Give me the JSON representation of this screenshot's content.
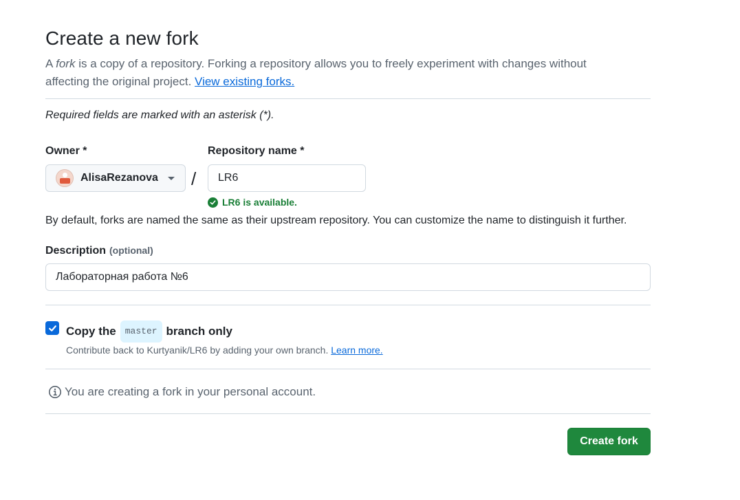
{
  "header": {
    "title": "Create a new fork",
    "intro_a": "A ",
    "intro_fork": "fork",
    "intro_b": " is a copy of a repository. Forking a repository allows you to freely experiment with changes without affecting the original project. ",
    "view_forks_link": "View existing forks."
  },
  "form": {
    "required_note": "Required fields are marked with an asterisk (*).",
    "owner": {
      "label": "Owner *",
      "value": "AlisaRezanova"
    },
    "separator": "/",
    "repo_name": {
      "label": "Repository name *",
      "value": "LR6",
      "status": "LR6 is available."
    },
    "help_text": "By default, forks are named the same as their upstream repository. You can customize the name to distinguish it further.",
    "description": {
      "label": "Description",
      "optional": "(optional)",
      "value": "Лабораторная работа №6"
    },
    "copy_branch": {
      "checked": true,
      "label_a": "Copy the",
      "branch": "master",
      "label_b": "branch only",
      "sub_text": "Contribute back to Kurtyanik/LR6 by adding your own branch. ",
      "learn_more": "Learn more."
    },
    "info": "You are creating a fork in your personal account.",
    "submit_label": "Create fork"
  },
  "colors": {
    "primary_button": "#1f883d",
    "link": "#0969da",
    "success": "#1a7f37",
    "checkbox": "#0969da"
  },
  "icons": {
    "owner_avatar": "avatar",
    "owner_dropdown": "caret-down-icon",
    "available": "check-circle-icon",
    "checkbox": "checkmark-icon",
    "info": "info-icon"
  }
}
